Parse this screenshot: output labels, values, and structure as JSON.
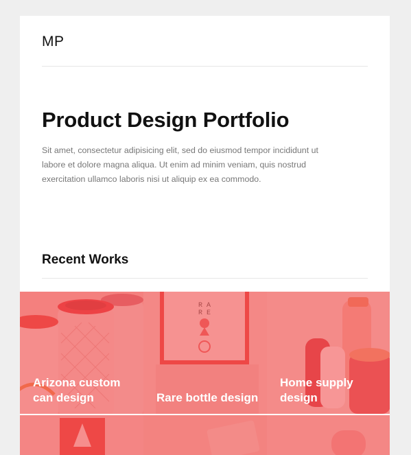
{
  "header": {
    "brand": "MP"
  },
  "hero": {
    "title": "Product Design Portfolio",
    "description": "Sit amet, consectetur adipisicing elit, sed do eiusmod tempor incididunt ut labore et dolore magna aliqua. Ut enim ad minim veniam, quis nostrud exercitation ullamco laboris nisi ut aliquip ex ea commodo."
  },
  "recent_works": {
    "title": "Recent Works",
    "items": [
      {
        "label": "Arizona custom can design"
      },
      {
        "label": "Rare bottle design"
      },
      {
        "label": "Home supply design"
      }
    ]
  },
  "colors": {
    "overlay": "#f25656",
    "background": "#efefef",
    "card": "#ffffff",
    "accent_dark": "#e8332f"
  },
  "icons": [
    "cans-illustration",
    "bottle-box-illustration",
    "home-supply-illustration"
  ]
}
